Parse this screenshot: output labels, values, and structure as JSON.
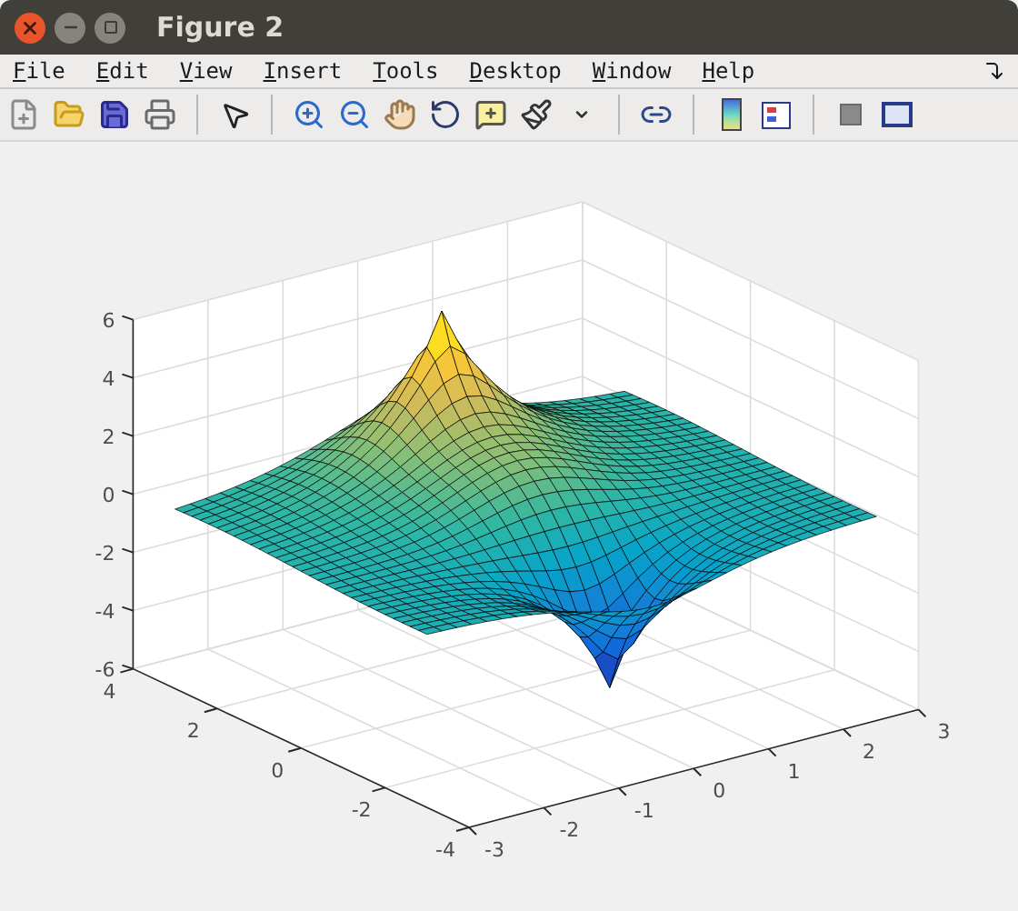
{
  "window": {
    "title": "Figure 2"
  },
  "menu": [
    {
      "label": "File"
    },
    {
      "label": "Edit"
    },
    {
      "label": "View"
    },
    {
      "label": "Insert"
    },
    {
      "label": "Tools"
    },
    {
      "label": "Desktop"
    },
    {
      "label": "Window"
    },
    {
      "label": "Help"
    }
  ],
  "axes": {
    "z_ticks": [
      "6",
      "4",
      "2",
      "0",
      "-2",
      "-4",
      "-6"
    ],
    "y_ticks": [
      "4",
      "2",
      "0",
      "-2",
      "-4"
    ],
    "x_ticks": [
      "-3",
      "-2",
      "-1",
      "0",
      "1",
      "2",
      "3"
    ]
  }
}
